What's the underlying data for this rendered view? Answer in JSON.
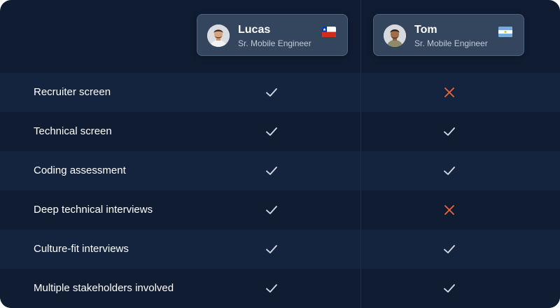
{
  "colors": {
    "background": "#101c32",
    "row_highlight": "#14243e",
    "card": "#34455e",
    "check": "#d7dde6",
    "cross": "#f0643c"
  },
  "candidates": [
    {
      "name": "Lucas",
      "role": "Sr. Mobile Engineer",
      "flag_icon": "chile-flag-icon",
      "avatar_icon": "avatar-photo-lucas"
    },
    {
      "name": "Tom",
      "role": "Sr. Mobile Engineer",
      "flag_icon": "argentina-flag-icon",
      "avatar_icon": "avatar-photo-tom"
    }
  ],
  "rows": [
    {
      "label": "Recruiter screen",
      "status": [
        "check",
        "cross"
      ]
    },
    {
      "label": "Technical screen",
      "status": [
        "check",
        "check"
      ]
    },
    {
      "label": "Coding assessment",
      "status": [
        "check",
        "check"
      ]
    },
    {
      "label": "Deep technical interviews",
      "status": [
        "check",
        "cross"
      ]
    },
    {
      "label": "Culture-fit interviews",
      "status": [
        "check",
        "check"
      ]
    },
    {
      "label": "Multiple stakeholders involved",
      "status": [
        "check",
        "check"
      ]
    }
  ]
}
